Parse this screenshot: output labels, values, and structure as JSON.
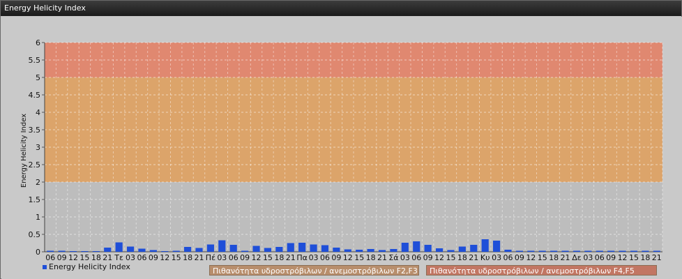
{
  "window": {
    "title": "Energy Helicity Index"
  },
  "colors": {
    "band_low": "#bdbdbd",
    "band_mid": "#dca46a",
    "band_high": "#e08870",
    "bar": "#1f4fd8",
    "legend_mid": "#b88e6c",
    "legend_high": "#c27663"
  },
  "legend": {
    "series_label": "Energy Helicity Index",
    "band_mid_label": "Πιθανότητα υδροστρόβιλων / ανεμοστρόβιλων F2,F3",
    "band_high_label": "Πιθανότητα υδροστρόβιλων / ανεμοστρόβιλων F4,F5"
  },
  "chart_data": {
    "type": "bar",
    "ylabel": "Energy Helicity Index",
    "ylim": [
      0,
      6
    ],
    "yticks": [
      "0",
      "0.5",
      "1",
      "1.5",
      "2",
      "2.5",
      "3",
      "3.5",
      "4",
      "4.5",
      "5",
      "5.5",
      "6"
    ],
    "bands": [
      {
        "from": 2,
        "to": 5,
        "label": "Πιθανότητα υδροστρόβιλων / ανεμοστρόβιλων F2,F3"
      },
      {
        "from": 5,
        "to": 6,
        "label": "Πιθανότητα υδροστρόβιλων / ανεμοστρόβιλων F4,F5"
      }
    ],
    "categories": [
      "06",
      "09",
      "12",
      "15",
      "18",
      "21",
      "Τε",
      "03",
      "06",
      "09",
      "12",
      "15",
      "18",
      "21",
      "Πέ",
      "03",
      "06",
      "09",
      "12",
      "15",
      "18",
      "21",
      "Πα",
      "03",
      "06",
      "09",
      "12",
      "15",
      "18",
      "21",
      "Σά",
      "03",
      "06",
      "09",
      "12",
      "15",
      "18",
      "21",
      "Κυ",
      "03",
      "06",
      "09",
      "12",
      "15",
      "18",
      "21",
      "Δε",
      "03",
      "06",
      "09",
      "12",
      "15",
      "18",
      "21"
    ],
    "series": [
      {
        "name": "Energy Helicity Index",
        "values": [
          0.03,
          0.03,
          0.02,
          0.02,
          0.02,
          0.12,
          0.27,
          0.15,
          0.09,
          0.05,
          0.02,
          0.03,
          0.14,
          0.11,
          0.21,
          0.33,
          0.2,
          0.03,
          0.17,
          0.11,
          0.14,
          0.25,
          0.26,
          0.21,
          0.19,
          0.12,
          0.07,
          0.06,
          0.08,
          0.05,
          0.08,
          0.26,
          0.3,
          0.2,
          0.1,
          0.05,
          0.15,
          0.2,
          0.36,
          0.32,
          0.06,
          0.03,
          0.03,
          0.03,
          0.03,
          0.03,
          0.03,
          0.03,
          0.03,
          0.03,
          0.03,
          0.03,
          0.03,
          0.03
        ]
      }
    ]
  }
}
